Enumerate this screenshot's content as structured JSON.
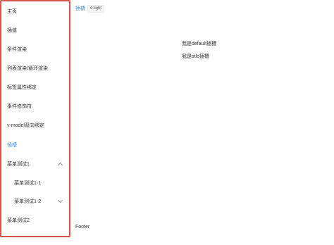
{
  "sidebar": {
    "items": [
      {
        "label": "主页"
      },
      {
        "label": "插值"
      },
      {
        "label": "条件渲染"
      },
      {
        "label": "列表渲染/循环渲染"
      },
      {
        "label": "标签属性绑定"
      },
      {
        "label": "事件修饰符"
      },
      {
        "label": "v-model双向绑定"
      },
      {
        "label": "插槽"
      },
      {
        "label": "菜单测试1"
      },
      {
        "label": "菜单测试1-1"
      },
      {
        "label": "菜单测试1-2"
      },
      {
        "label": "菜单测试2"
      }
    ],
    "border_color": "#d9534f",
    "active_color": "#5b8fd6"
  },
  "topbar": {
    "link_label": "插槽",
    "chip_label": "o:light"
  },
  "main": {
    "default_slot_text": "我是default插槽",
    "title_slot_text": "我是title插槽"
  },
  "footer": {
    "text": "Footer"
  }
}
